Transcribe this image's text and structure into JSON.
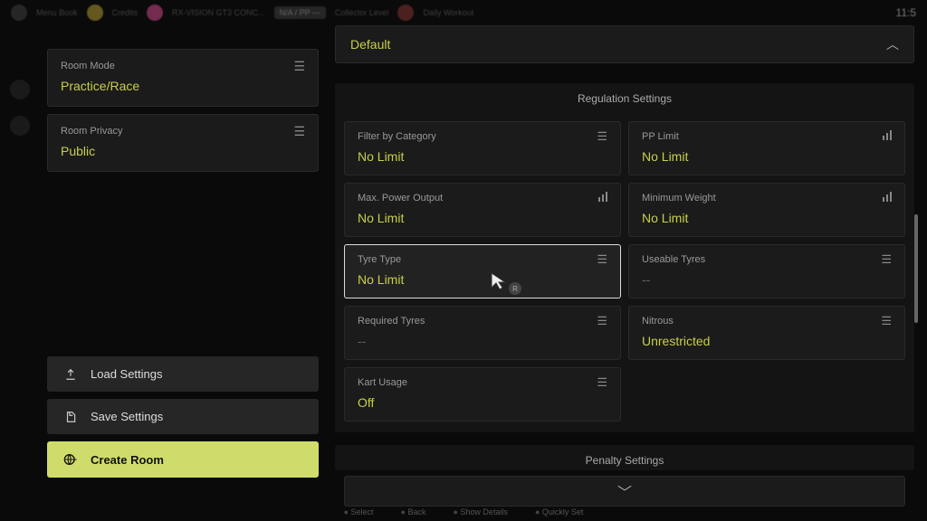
{
  "topbar": {
    "menu": "Menu Book",
    "credits_label": "Credits",
    "car": "RX-VISION GT3 CONC...",
    "collector_label": "Collector Level",
    "daily_label": "Daily Workout",
    "time": "11:5"
  },
  "sidebar": {
    "roomMode": {
      "label": "Room Mode",
      "value": "Practice/Race"
    },
    "roomPrivacy": {
      "label": "Room Privacy",
      "value": "Public"
    },
    "load": "Load Settings",
    "save": "Save Settings",
    "create": "Create Room"
  },
  "content": {
    "defaultLabel": "Default",
    "regulationTitle": "Regulation Settings",
    "penaltyTitle": "Penalty Settings",
    "tiles": {
      "filterCategory": {
        "label": "Filter by Category",
        "value": "No Limit"
      },
      "ppLimit": {
        "label": "PP Limit",
        "value": "No Limit"
      },
      "maxPower": {
        "label": "Max. Power Output",
        "value": "No Limit"
      },
      "minWeight": {
        "label": "Minimum Weight",
        "value": "No Limit"
      },
      "tyreType": {
        "label": "Tyre Type",
        "value": "No Limit"
      },
      "useableTyres": {
        "label": "Useable Tyres",
        "value": "--"
      },
      "requiredTyres": {
        "label": "Required Tyres",
        "value": "--"
      },
      "nitrous": {
        "label": "Nitrous",
        "value": "Unrestricted"
      },
      "kartUsage": {
        "label": "Kart Usage",
        "value": "Off"
      }
    }
  },
  "footer": {
    "a": "Select",
    "b": "Back",
    "c": "Show Details",
    "d": "Quickly Set"
  },
  "cursorBadge": "R"
}
